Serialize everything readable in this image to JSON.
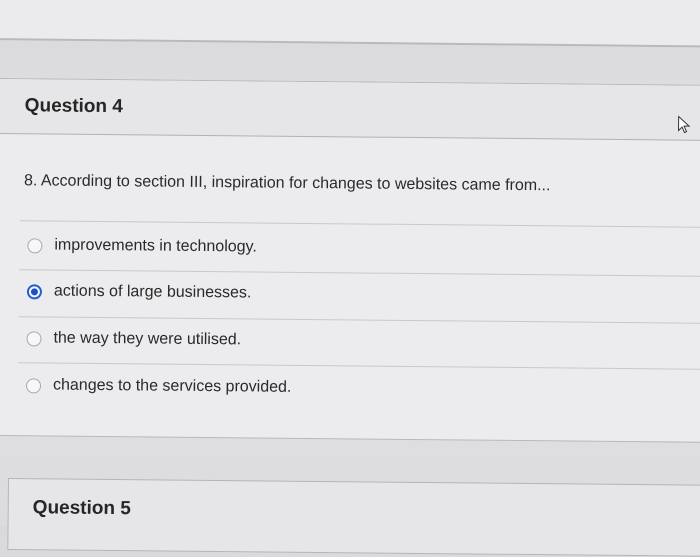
{
  "question4": {
    "header": "Question 4",
    "text": "8. According to section III, inspiration for changes to websites came from...",
    "answers": [
      {
        "label": "improvements in technology.",
        "selected": false
      },
      {
        "label": "actions of large businesses.",
        "selected": true
      },
      {
        "label": "the way they were utilised.",
        "selected": false
      },
      {
        "label": "changes to the services provided.",
        "selected": false
      }
    ]
  },
  "question5": {
    "header": "Question 5"
  },
  "colors": {
    "radio_selected": "#1f4fc4",
    "background": "#e3e3e5"
  },
  "icons": {
    "cursor": "mouse-pointer-icon"
  }
}
